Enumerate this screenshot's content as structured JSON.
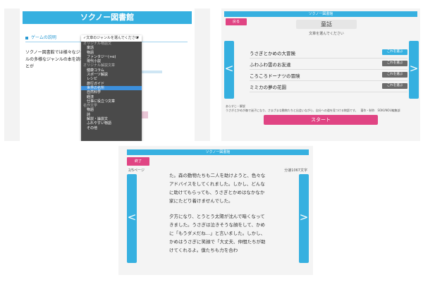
{
  "panel1": {
    "title": "ソクノー図書館",
    "section_title": "ゲームの説明",
    "description": "ソクノー図書館では様々なジャンルの多様なジャンルの本を読むことが",
    "dropdown": {
      "selected": "✓文章のジャンルを選んでください",
      "arrow": "▼",
      "groups": [
        {
          "label": "オリジナル物語文",
          "items": [
            "童話",
            "物語",
            "ファンタジー(+α)",
            "現代小説"
          ]
        },
        {
          "label": "オリジナル解説文章",
          "items": [
            "健康コラム",
            "スポーツ解説",
            "レシピ",
            "旅行ガイド",
            "世界の名所",
            "自然科学",
            "経済",
            "仕事に役立つ文章"
          ]
        },
        {
          "label": "名作文学",
          "items": [
            "物語",
            "詩",
            "解説・論説文",
            "ふれやすい物語",
            "その他"
          ]
        }
      ],
      "highlighted": "世界の名所"
    }
  },
  "panel2": {
    "title": "ソクノー図書館",
    "back_label": "戻る",
    "genre": "童話",
    "prompt": "文章を選んでください",
    "nav_left": "<",
    "nav_right": ">",
    "stories": [
      {
        "title": "うさぎとかめの大冒険",
        "button": "これを選ぶ",
        "button_color": "#36b0e0"
      },
      {
        "title": "ふわふわ雲のお友達",
        "button": "これを選ぶ",
        "button_color": "#6b6b6b"
      },
      {
        "title": "ころころドーナツの冒険",
        "button": "これを選ぶ",
        "button_color": "#6b6b6b"
      },
      {
        "title": "ミミカの夢の花園",
        "button": "これを選ぶ",
        "button_color": "#6b6b6b"
      }
    ],
    "note_1": "あらすじ・解説",
    "note_2": "うさぎとかめが森で迷子になり、さまざまな動物たちと出会いながら、自分への道を見つける物語です。　著作・制作　SOKUNOU編集部",
    "start_label": "スタート"
  },
  "panel3": {
    "title": "ソクノー図書館",
    "back_label": "終了",
    "page": "2/5ページ",
    "speed": "分速1067文字",
    "nav_left": "<",
    "nav_right": ">",
    "paragraph1": "た。森の動物たちも二人を助けようと、色々なアドバイスをしてくれました。しかし、どんなに助けてもらっても、うさぎとかめはなかなか家にたどり着けませんでした。",
    "paragraph2": "夕方になり、とうとう太陽が沈んで暗くなってきました。うさぎは泣きそうな顔をして、かめに「もうダメだね…」と言いました。しかし、かめはうさぎに笑顔で「大丈夫、仲間たちが助けてくれるよ。僕たちも力を合わ"
  }
}
